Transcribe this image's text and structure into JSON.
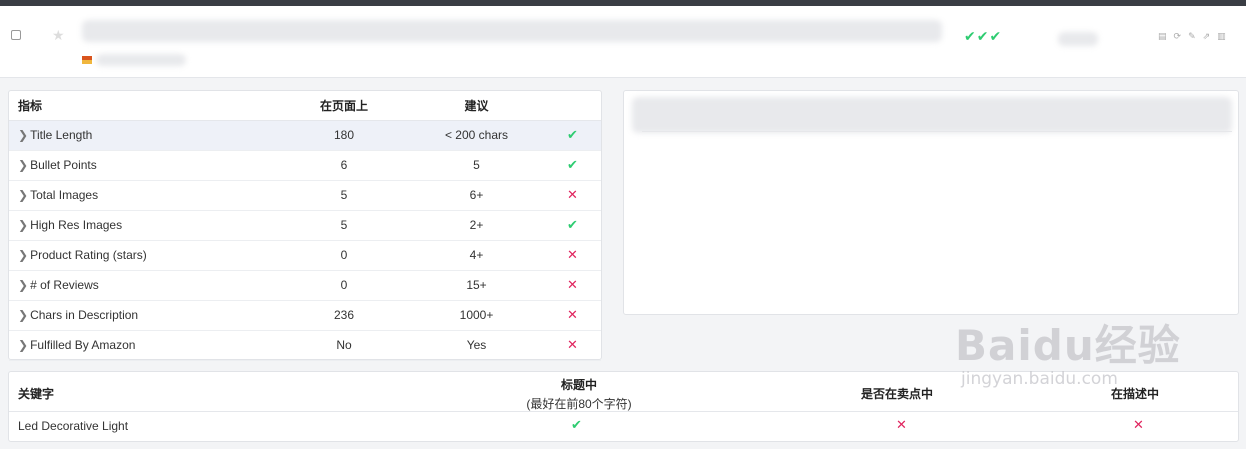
{
  "product": {
    "checks": "✔✔✔"
  },
  "metrics": {
    "headers": [
      "指标",
      "在页面上",
      "建议"
    ],
    "rows": [
      {
        "label": "Title Length",
        "on_page": "180",
        "recommended": "< 200 chars",
        "status": "pass"
      },
      {
        "label": "Bullet Points",
        "on_page": "6",
        "recommended": "5",
        "status": "pass"
      },
      {
        "label": "Total Images",
        "on_page": "5",
        "recommended": "6+",
        "status": "fail"
      },
      {
        "label": "High Res Images",
        "on_page": "5",
        "recommended": "2+",
        "status": "pass"
      },
      {
        "label": "Product Rating (stars)",
        "on_page": "0",
        "recommended": "4+",
        "status": "fail"
      },
      {
        "label": "# of Reviews",
        "on_page": "0",
        "recommended": "15+",
        "status": "fail"
      },
      {
        "label": "Chars in Description",
        "on_page": "236",
        "recommended": "1000+",
        "status": "fail"
      },
      {
        "label": "Fulfilled By Amazon",
        "on_page": "No",
        "recommended": "Yes",
        "status": "fail"
      }
    ]
  },
  "keywords": {
    "headers": {
      "keyword": "关键字",
      "in_title": "标题中",
      "in_title_note": "(最好在前80个字符)",
      "in_bullets": "是否在卖点中",
      "in_description": "在描述中"
    },
    "rows": [
      {
        "keyword": "Led Decorative Light",
        "in_title": "pass",
        "in_bullets": "fail",
        "in_description": "fail"
      }
    ]
  },
  "symbols": {
    "pass": "✔",
    "fail": "✕",
    "chevron": "❯"
  },
  "watermark": {
    "brand": "Baidu经验",
    "url": "jingyan.baidu.com"
  },
  "colors": {
    "pass": "#2ecc71",
    "fail": "#e0245e",
    "active_row": "#eef1f8"
  }
}
